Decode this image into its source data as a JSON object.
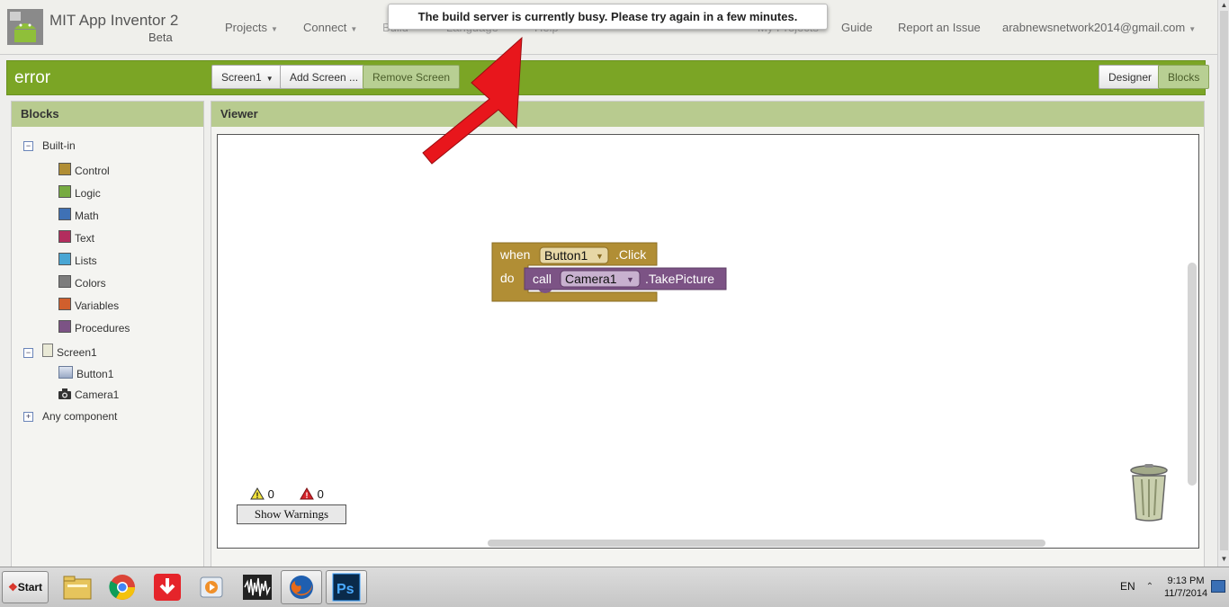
{
  "app": {
    "title": "MIT App Inventor 2",
    "subtitle": "Beta"
  },
  "nav": {
    "projects": "Projects",
    "connect": "Connect",
    "build": "Build",
    "language": "Language",
    "help": "Help",
    "my_projects": "My Projects",
    "guide": "Guide",
    "report": "Report an Issue",
    "account": "arabnewsnetwork2014@gmail.com"
  },
  "toast": "The build server is currently busy. Please try again in a few minutes.",
  "toolbar": {
    "project_name": "error",
    "screen_select": "Screen1",
    "add_screen": "Add Screen ...",
    "remove_screen": "Remove Screen",
    "designer": "Designer",
    "blocks": "Blocks"
  },
  "blocks_panel": {
    "title": "Blocks",
    "builtin": "Built-in",
    "categories": [
      {
        "label": "Control",
        "color": "#b18e35"
      },
      {
        "label": "Logic",
        "color": "#77ab41"
      },
      {
        "label": "Math",
        "color": "#3f71b5"
      },
      {
        "label": "Text",
        "color": "#b32d5e"
      },
      {
        "label": "Lists",
        "color": "#49a6d4"
      },
      {
        "label": "Colors",
        "color": "#7d7d7d"
      },
      {
        "label": "Variables",
        "color": "#d05f2d"
      },
      {
        "label": "Procedures",
        "color": "#7c5385"
      }
    ],
    "screen": "Screen1",
    "components": [
      "Button1",
      "Camera1"
    ],
    "any_component": "Any component"
  },
  "viewer": {
    "title": "Viewer",
    "event_block": {
      "when": "when",
      "component": "Button1",
      "event": ".Click",
      "do": "do",
      "color": "#b18e35"
    },
    "call_block": {
      "call": "call",
      "component": "Camera1",
      "method": ".TakePicture",
      "color": "#7c5385"
    },
    "warning_count": "0",
    "error_count": "0",
    "show_warnings": "Show Warnings"
  },
  "taskbar": {
    "start": "Start",
    "language": "EN",
    "time": "9:13 PM",
    "date": "11/7/2014",
    "apps": [
      "file-explorer-icon",
      "chrome-icon",
      "download-manager-icon",
      "media-player-icon",
      "audio-editor-icon",
      "firefox-icon",
      "photoshop-icon"
    ]
  }
}
